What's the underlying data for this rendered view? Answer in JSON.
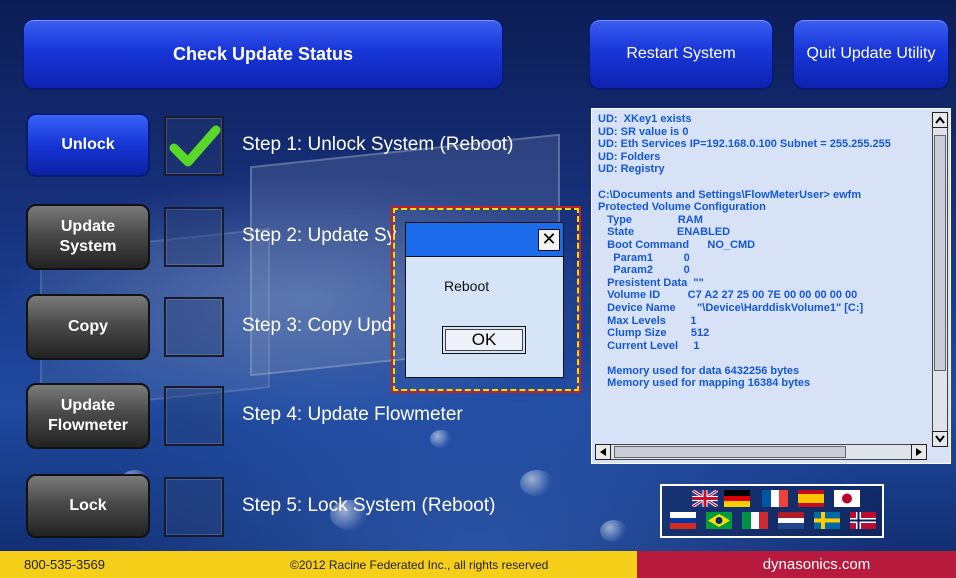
{
  "header": {
    "check_status_label": "Check Update Status",
    "restart_label": "Restart System",
    "quit_label": "Quit Update Utility"
  },
  "steps": [
    {
      "button": "Unlock",
      "button_style": "blue",
      "checked": true,
      "text": "Step 1: Unlock System (Reboot)"
    },
    {
      "button": "Update\nSystem",
      "button_style": "gray",
      "checked": false,
      "text": "Step 2: Update Sy"
    },
    {
      "button": "Copy",
      "button_style": "gray",
      "checked": false,
      "text": "Step 3: Copy Upd"
    },
    {
      "button": "Update\nFlowmeter",
      "button_style": "gray",
      "checked": false,
      "text": "Step 4: Update Flowmeter"
    },
    {
      "button": "Lock",
      "button_style": "gray",
      "checked": false,
      "text": "Step 5: Lock System (Reboot)"
    }
  ],
  "log": {
    "lines": [
      "UD:  XKey1 exists",
      "UD: SR value is 0",
      "UD: Eth Services IP=192.168.0.100 Subnet = 255.255.255",
      "UD: Folders",
      "UD: Registry",
      "",
      "C:\\Documents and Settings\\FlowMeterUser> ewfm",
      "Protected Volume Configuration",
      "   Type               RAM",
      "   State              ENABLED",
      "   Boot Command      NO_CMD",
      "     Param1          0",
      "     Param2          0",
      "   Presistent Data  \"\"",
      "   Volume ID         C7 A2 27 25 00 7E 00 00 00 00 00",
      "   Device Name       \"\\Device\\HarddiskVolume1\" [C:]",
      "   Max Levels        1",
      "   Clump Size        512",
      "   Current Level     1",
      "",
      "   Memory used for data 6432256 bytes",
      "   Memory used for mapping 16384 bytes"
    ]
  },
  "dialog": {
    "message": "Reboot",
    "ok_label": "OK",
    "close_glyph": "✕"
  },
  "flags": [
    "uk",
    "germany",
    "france",
    "spain",
    "japan",
    "russia",
    "brazil",
    "italy",
    "netherlands",
    "sweden",
    "norway"
  ],
  "footer": {
    "phone": "800-535-3569",
    "copyright": "©2012 Racine Federated Inc., all rights reserved",
    "website": "dynasonics.com"
  },
  "colors": {
    "accent_blue": "#1836d8",
    "log_text": "#1558d6",
    "footer_yellow": "#f6cf1a",
    "footer_red": "#b81a3e",
    "check_green": "#5ad82a"
  }
}
